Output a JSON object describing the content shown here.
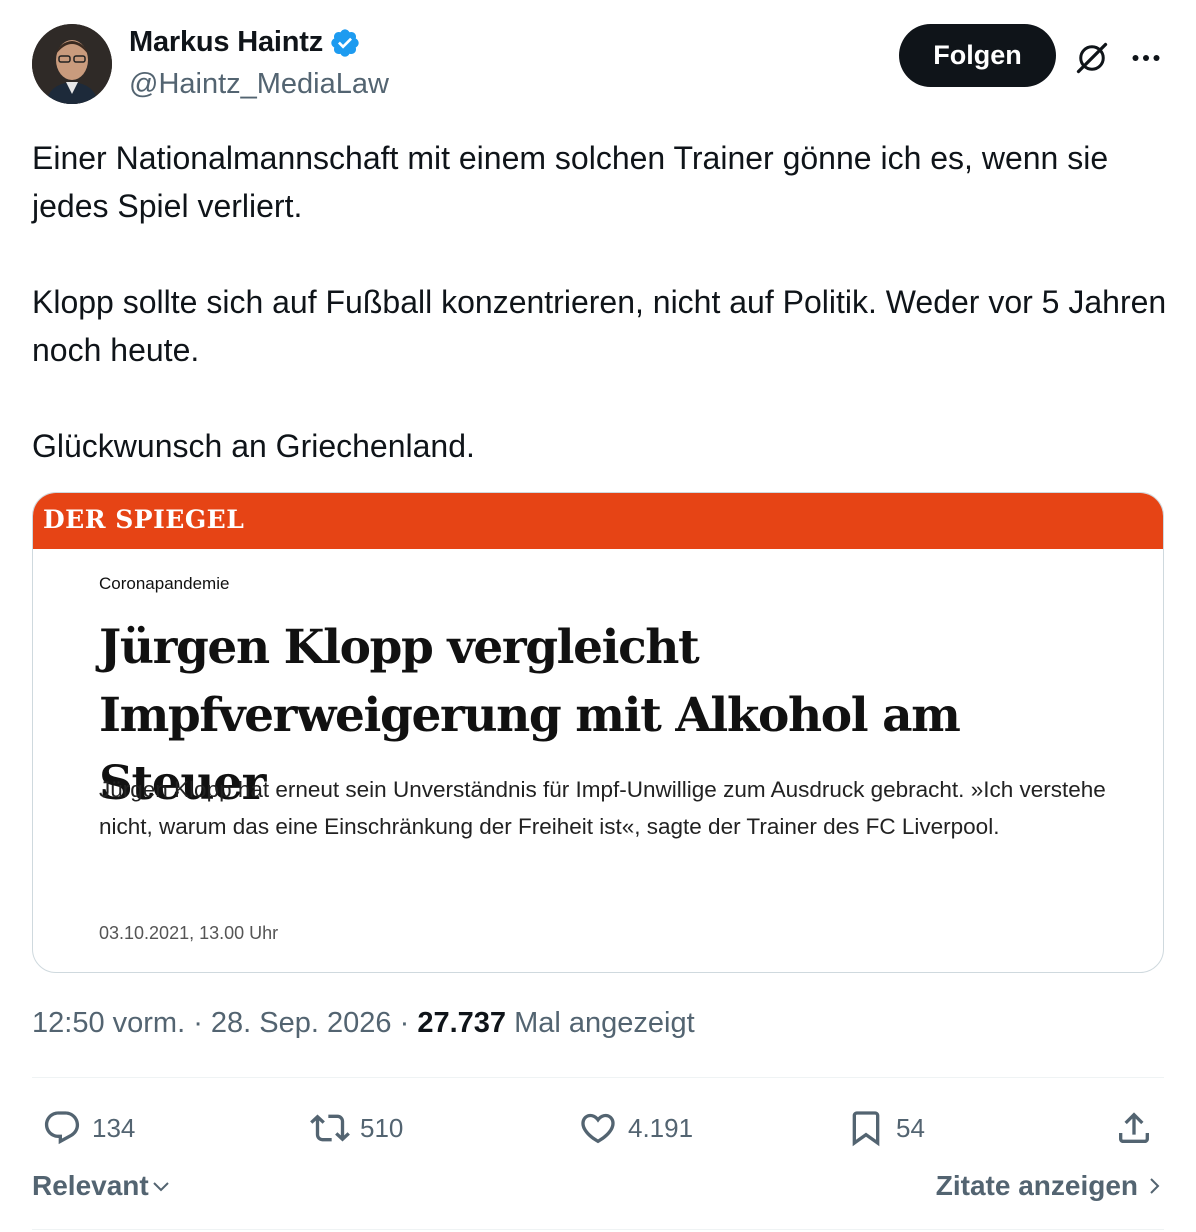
{
  "author": {
    "name": "Markus Haintz",
    "handle": "@Haintz_MediaLaw",
    "verified": true
  },
  "follow_label": "Folgen",
  "tweet_lines": [
    "Einer Nationalmannschaft mit einem solchen Trainer gönne ich es, wenn sie jedes Spiel verliert.",
    "Klopp sollte sich auf Fußball konzentrieren, nicht auf Politik. Weder vor 5 Jahren noch heute.",
    "Glückwunsch an Griechenland."
  ],
  "card": {
    "brand": "DER SPIEGEL",
    "brand_color": "#e64415",
    "kicker": "Coronapandemie",
    "title": "Jürgen Klopp vergleicht Impfverweigerung mit Alkohol am Steuer",
    "body": "Jürgen Klopp hat erneut sein Unverständnis für Impf-Unwillige zum Ausdruck gebracht. »Ich verstehe nicht, warum das eine Einschränkung der Freiheit ist«, sagte der Trainer des FC Liverpool.",
    "date": "03.10.2021, 13.00 Uhr"
  },
  "meta": {
    "time": "12:50 vorm.",
    "separator": " · ",
    "date": "28. Sep. 2026",
    "views": "27.737",
    "views_label": "Mal angezeigt"
  },
  "actions": {
    "replies": "134",
    "reposts": "510",
    "likes": "4.191",
    "bookmarks": "54"
  },
  "footer": {
    "sort_label": "Relevant",
    "quotes_label": "Zitate anzeigen"
  },
  "colors": {
    "verified_blue": "#1d9bf0",
    "text_primary": "#0f1419",
    "text_secondary": "#536471"
  },
  "icons": [
    "verified-badge-icon",
    "grok-icon",
    "more-icon",
    "reply-icon",
    "repost-icon",
    "like-icon",
    "bookmark-icon",
    "share-icon",
    "chevron-down-icon",
    "chevron-right-icon"
  ]
}
